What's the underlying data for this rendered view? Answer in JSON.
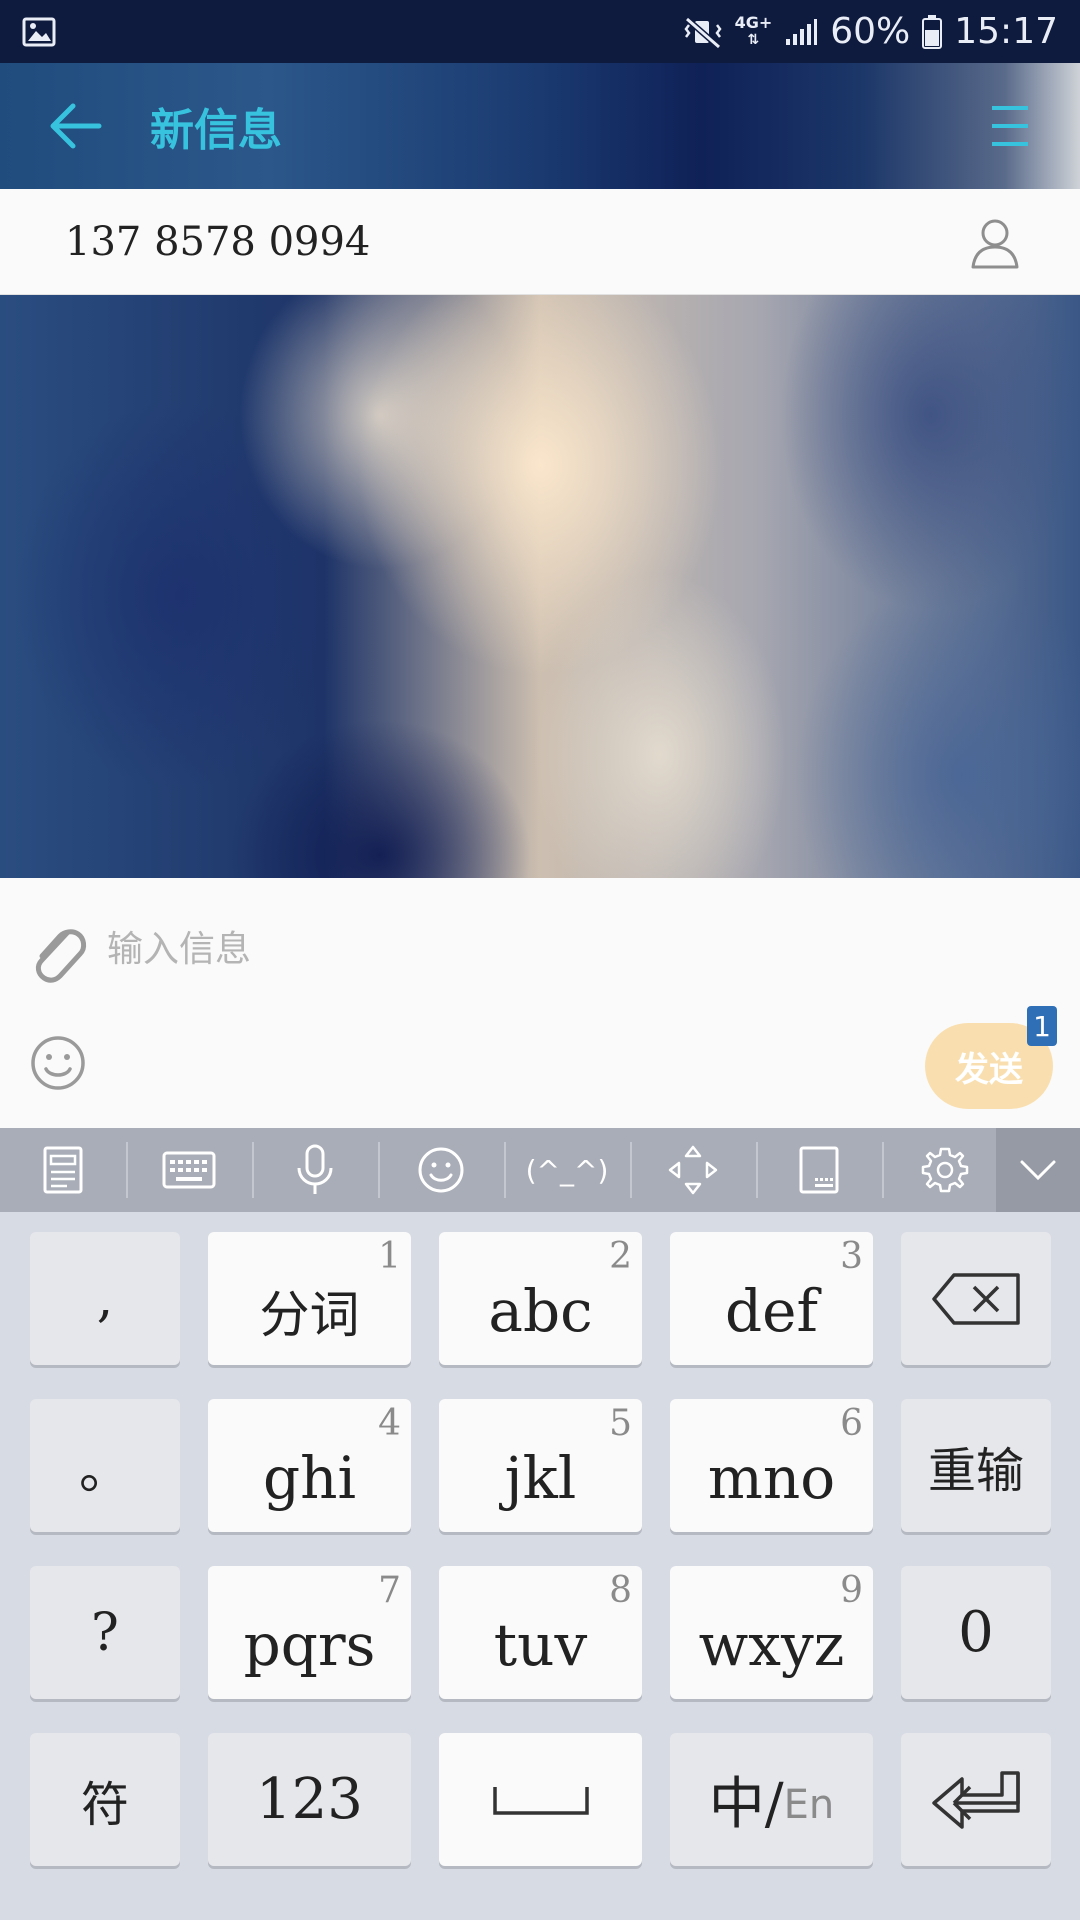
{
  "status_bar": {
    "network": "4G+",
    "battery": "60%",
    "time": "15:17"
  },
  "header": {
    "title": "新信息"
  },
  "recipient": {
    "number": "137 8578 0994"
  },
  "compose": {
    "placeholder": "输入信息",
    "send_label": "发送",
    "sim_badge": "1"
  },
  "keyboard_toolbar": {
    "emoticon_label": "(^_^)"
  },
  "keyboard": {
    "left_column": [
      ",",
      "。",
      "?",
      "符"
    ],
    "digit_keys": [
      {
        "label": "分词",
        "num": "1"
      },
      {
        "label": "abc",
        "num": "2"
      },
      {
        "label": "def",
        "num": "3"
      },
      {
        "label": "ghi",
        "num": "4"
      },
      {
        "label": "jkl",
        "num": "5"
      },
      {
        "label": "mno",
        "num": "6"
      },
      {
        "label": "pqrs",
        "num": "7"
      },
      {
        "label": "tuv",
        "num": "8"
      },
      {
        "label": "wxyz",
        "num": "9"
      }
    ],
    "reenter_label": "重输",
    "zero_label": "0",
    "num_mode_label": "123",
    "lang_main": "中/",
    "lang_sub": "En"
  },
  "colors": {
    "accent": "#37c2de",
    "send_button": "#f9dfb0",
    "sim_badge": "#2f6fb6",
    "status_bar": "#0e1a3e"
  }
}
